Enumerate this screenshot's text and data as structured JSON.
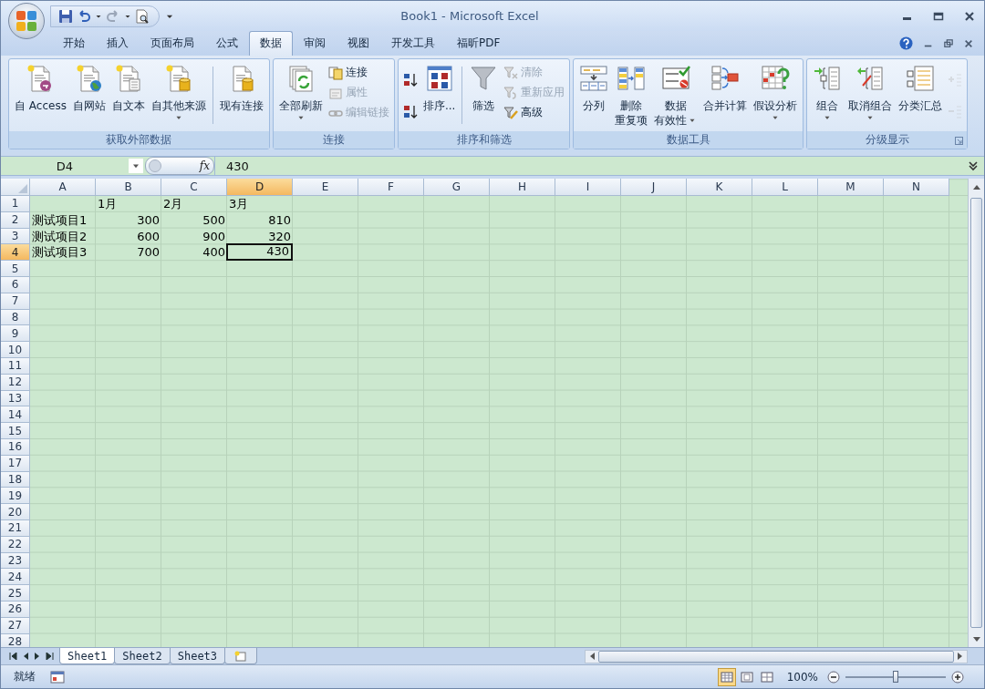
{
  "window": {
    "title": "Book1 - Microsoft Excel"
  },
  "tabs": [
    {
      "label": "开始",
      "selected": false
    },
    {
      "label": "插入",
      "selected": false
    },
    {
      "label": "页面布局",
      "selected": false
    },
    {
      "label": "公式",
      "selected": false
    },
    {
      "label": "数据",
      "selected": true
    },
    {
      "label": "审阅",
      "selected": false
    },
    {
      "label": "视图",
      "selected": false
    },
    {
      "label": "开发工具",
      "selected": false
    },
    {
      "label": "福昕PDF",
      "selected": false
    }
  ],
  "ribbon_groups": [
    {
      "title": "获取外部数据",
      "dialog_launcher": false,
      "buttons": [
        {
          "kind": "large",
          "lines": [
            "自 Access"
          ],
          "dropdown": false,
          "disabled": false
        },
        {
          "kind": "large",
          "lines": [
            "自网站"
          ],
          "dropdown": false,
          "disabled": false
        },
        {
          "kind": "large",
          "lines": [
            "自文本"
          ],
          "dropdown": false,
          "disabled": false
        },
        {
          "kind": "large",
          "lines": [
            "自其他来源"
          ],
          "dropdown": true,
          "disabled": false
        },
        {
          "kind": "separator"
        },
        {
          "kind": "large",
          "lines": [
            "现有连接"
          ],
          "dropdown": false,
          "disabled": false
        }
      ]
    },
    {
      "title": "连接",
      "dialog_launcher": false,
      "buttons": [
        {
          "kind": "large",
          "lines": [
            "全部刷新"
          ],
          "dropdown": true,
          "disabled": false
        },
        {
          "kind": "small",
          "label": "连接",
          "disabled": false
        },
        {
          "kind": "small",
          "label": "属性",
          "disabled": true
        },
        {
          "kind": "small",
          "label": "编辑链接",
          "disabled": true
        }
      ]
    },
    {
      "title": "排序和筛选",
      "dialog_launcher": false,
      "buttons": [
        {
          "kind": "icon",
          "disabled": false
        },
        {
          "kind": "icon",
          "disabled": false
        },
        {
          "kind": "large",
          "lines": [
            "排序..."
          ],
          "dropdown": false,
          "disabled": false
        },
        {
          "kind": "separator"
        },
        {
          "kind": "large",
          "lines": [
            "筛选"
          ],
          "dropdown": false,
          "disabled": false
        },
        {
          "kind": "small",
          "label": "清除",
          "disabled": true
        },
        {
          "kind": "small",
          "label": "重新应用",
          "disabled": true
        },
        {
          "kind": "small",
          "label": "高级",
          "disabled": false
        }
      ]
    },
    {
      "title": "数据工具",
      "dialog_launcher": false,
      "buttons": [
        {
          "kind": "large",
          "lines": [
            "分列"
          ],
          "dropdown": false,
          "disabled": false
        },
        {
          "kind": "large",
          "lines": [
            "删除",
            "重复项"
          ],
          "dropdown": false,
          "disabled": false
        },
        {
          "kind": "large",
          "lines": [
            "数据",
            "有效性"
          ],
          "dropdown": true,
          "disabled": false
        },
        {
          "kind": "large",
          "lines": [
            "合并计算"
          ],
          "dropdown": false,
          "disabled": false
        },
        {
          "kind": "large",
          "lines": [
            "假设分析"
          ],
          "dropdown": true,
          "disabled": false
        }
      ]
    },
    {
      "title": "分级显示",
      "dialog_launcher": true,
      "buttons": [
        {
          "kind": "large",
          "lines": [
            "组合"
          ],
          "dropdown": true,
          "disabled": false
        },
        {
          "kind": "large",
          "lines": [
            "取消组合"
          ],
          "dropdown": true,
          "disabled": false
        },
        {
          "kind": "large",
          "lines": [
            "分类汇总"
          ],
          "dropdown": false,
          "disabled": false
        },
        {
          "kind": "icon",
          "disabled": true
        },
        {
          "kind": "icon",
          "disabled": true
        }
      ]
    }
  ],
  "formula_bar": {
    "name_box": "D4",
    "function_button": "fx",
    "value": "430"
  },
  "sheet": {
    "columns": [
      {
        "label": "A",
        "selected": false
      },
      {
        "label": "B",
        "selected": false
      },
      {
        "label": "C",
        "selected": false
      },
      {
        "label": "D",
        "selected": true
      },
      {
        "label": "E",
        "selected": false
      },
      {
        "label": "F",
        "selected": false
      },
      {
        "label": "G",
        "selected": false
      },
      {
        "label": "H",
        "selected": false
      },
      {
        "label": "I",
        "selected": false
      },
      {
        "label": "J",
        "selected": false
      },
      {
        "label": "K",
        "selected": false
      },
      {
        "label": "L",
        "selected": false
      },
      {
        "label": "M",
        "selected": false
      },
      {
        "label": "N",
        "selected": false
      }
    ],
    "rows": [
      {
        "label": "1",
        "selected": false,
        "cells": [
          {
            "selected": false
          },
          {
            "kind": "text",
            "value": "1月",
            "selected": false
          },
          {
            "kind": "text",
            "value": "2月",
            "selected": false
          },
          {
            "kind": "text",
            "value": "3月",
            "selected": false
          }
        ]
      },
      {
        "label": "2",
        "selected": false,
        "cells": [
          {
            "kind": "text",
            "value": "测试项目1",
            "selected": false
          },
          {
            "kind": "number",
            "value": "300",
            "selected": false
          },
          {
            "kind": "number",
            "value": "500",
            "selected": false
          },
          {
            "kind": "number",
            "value": "810",
            "selected": false
          }
        ]
      },
      {
        "label": "3",
        "selected": false,
        "cells": [
          {
            "kind": "text",
            "value": "测试项目2",
            "selected": false
          },
          {
            "kind": "number",
            "value": "600",
            "selected": false
          },
          {
            "kind": "number",
            "value": "900",
            "selected": false
          },
          {
            "kind": "number",
            "value": "320",
            "selected": false
          }
        ]
      },
      {
        "label": "4",
        "selected": true,
        "cells": [
          {
            "kind": "text",
            "value": "测试项目3",
            "selected": false
          },
          {
            "kind": "number",
            "value": "700",
            "selected": false
          },
          {
            "kind": "number",
            "value": "400",
            "selected": false
          },
          {
            "kind": "number",
            "value": "430",
            "selected": true
          }
        ]
      },
      {
        "label": "5",
        "selected": false
      },
      {
        "label": "6",
        "selected": false
      },
      {
        "label": "7",
        "selected": false
      },
      {
        "label": "8",
        "selected": false
      },
      {
        "label": "9",
        "selected": false
      },
      {
        "label": "10",
        "selected": false
      },
      {
        "label": "11",
        "selected": false
      },
      {
        "label": "12",
        "selected": false
      },
      {
        "label": "13",
        "selected": false
      },
      {
        "label": "14",
        "selected": false
      },
      {
        "label": "15",
        "selected": false
      },
      {
        "label": "16",
        "selected": false
      },
      {
        "label": "17",
        "selected": false
      },
      {
        "label": "18",
        "selected": false
      },
      {
        "label": "19",
        "selected": false
      },
      {
        "label": "20",
        "selected": false
      },
      {
        "label": "21",
        "selected": false
      },
      {
        "label": "22",
        "selected": false
      },
      {
        "label": "23",
        "selected": false
      },
      {
        "label": "24",
        "selected": false
      },
      {
        "label": "25",
        "selected": false
      },
      {
        "label": "26",
        "selected": false
      },
      {
        "label": "27",
        "selected": false
      },
      {
        "label": "28",
        "selected": false
      }
    ]
  },
  "sheet_tabs": [
    {
      "label": "Sheet1",
      "selected": true
    },
    {
      "label": "Sheet2",
      "selected": false
    },
    {
      "label": "Sheet3",
      "selected": false
    }
  ],
  "status_bar": {
    "text": "就绪",
    "view_buttons": [
      {
        "selected": true
      },
      {
        "selected": false
      },
      {
        "selected": false
      }
    ],
    "zoom": "100%",
    "zoom_slider": {
      "level": 0.5
    }
  }
}
